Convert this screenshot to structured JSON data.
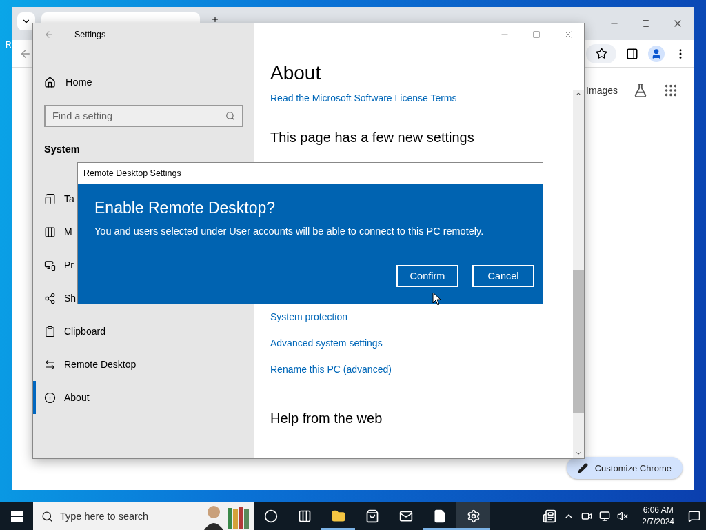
{
  "desktop": {
    "icon_label": "R"
  },
  "browser": {
    "images_link": "Images",
    "customize_button": "Customize Chrome"
  },
  "settings": {
    "title": "Settings",
    "home": "Home",
    "search": {
      "placeholder": "Find a setting"
    },
    "section": "System",
    "nav": [
      {
        "label": "Ta",
        "kind": "tablet",
        "selected": false
      },
      {
        "label": "M",
        "kind": "multitask",
        "selected": false
      },
      {
        "label": "Pr",
        "kind": "project",
        "selected": false
      },
      {
        "label": "Sh",
        "kind": "shared",
        "selected": false
      },
      {
        "label": "Clipboard",
        "kind": "clipboard",
        "selected": false
      },
      {
        "label": "Remote Desktop",
        "kind": "remote",
        "selected": false
      },
      {
        "label": "About",
        "kind": "info",
        "selected": true
      }
    ],
    "page_title": "About",
    "license_link": "Read the Microsoft Software License Terms",
    "new_settings_heading": "This page has a few new settings",
    "related_links": [
      "System protection",
      "Advanced system settings",
      "Rename this PC (advanced)"
    ],
    "help_heading": "Help from the web"
  },
  "dialog": {
    "title": "Remote Desktop Settings",
    "heading": "Enable Remote Desktop?",
    "message": "You and users selected under User accounts will be able to connect to this PC remotely.",
    "buttons": [
      "Confirm",
      "Cancel"
    ]
  },
  "taskbar": {
    "search": {
      "placeholder": "Type here to search"
    },
    "apps": [
      {
        "kind": "cortana",
        "running": false,
        "selected": false
      },
      {
        "kind": "taskview",
        "running": false,
        "selected": false
      },
      {
        "kind": "explorer",
        "running": true,
        "selected": false
      },
      {
        "kind": "store",
        "running": false,
        "selected": false
      },
      {
        "kind": "mail",
        "running": false,
        "selected": false
      },
      {
        "kind": "notepad",
        "running": true,
        "selected": false
      },
      {
        "kind": "settings",
        "running": true,
        "selected": true
      }
    ],
    "clock": {
      "time": "6:06 AM",
      "date": "2/7/2024"
    }
  }
}
